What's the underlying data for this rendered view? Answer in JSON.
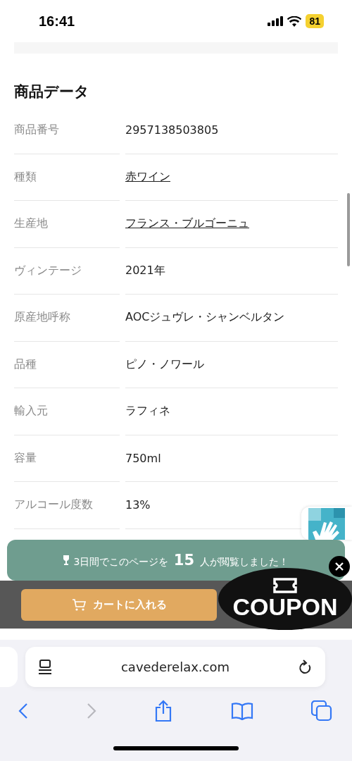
{
  "status_bar": {
    "time": "16:41",
    "battery": "81"
  },
  "section": {
    "title": "商品データ"
  },
  "rows": [
    {
      "label": "商品番号",
      "value": "2957138503805",
      "link": false
    },
    {
      "label": "種類",
      "value": "赤ワイン",
      "link": true
    },
    {
      "label": "生産地",
      "value": "フランス・ブルゴーニュ",
      "link": true
    },
    {
      "label": "ヴィンテージ",
      "value": "2021年",
      "link": false
    },
    {
      "label": "原産地呼称",
      "value": "AOCジュヴレ・シャンベルタン",
      "link": false
    },
    {
      "label": "品種",
      "value": "ピノ・ノワール",
      "link": false
    },
    {
      "label": "輸入元",
      "value": "ラフィネ",
      "link": false
    },
    {
      "label": "容量",
      "value": "750ml",
      "link": false
    },
    {
      "label": "アルコール度数",
      "value": "13%",
      "link": false
    }
  ],
  "views_banner": {
    "text": "3日間でこのページを **15** 人が閲覧しました！"
  },
  "cart_button": {
    "label": "カートに入れる"
  },
  "coupon": {
    "label": "COUPON"
  },
  "browser": {
    "url": "cavederelax.com",
    "back_disabled": false,
    "forward_disabled": true
  }
}
